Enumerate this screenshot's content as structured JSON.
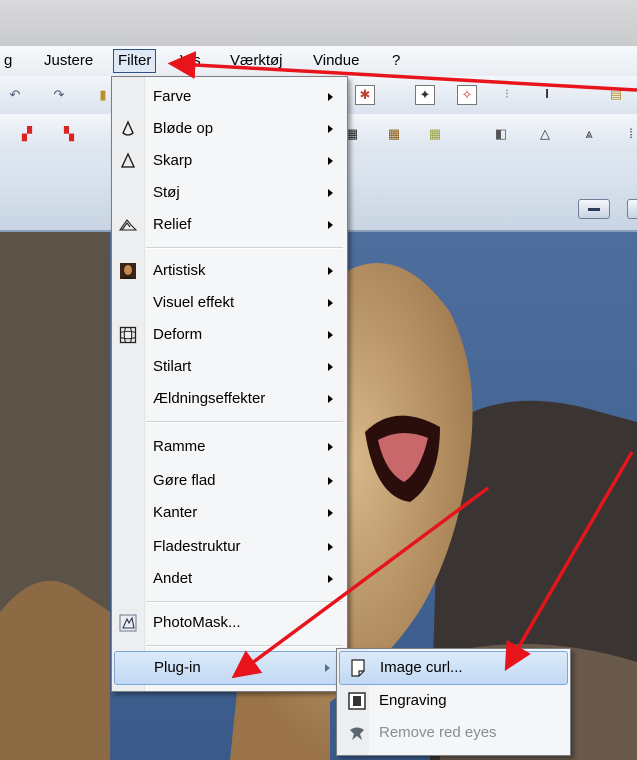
{
  "menubar": {
    "items": [
      "g",
      "Justere",
      "Filter",
      "Vis",
      "Værktøj",
      "Vindue",
      "?"
    ]
  },
  "filter_menu": {
    "items": [
      {
        "label": "Farve",
        "icon": "none",
        "submenu": true
      },
      {
        "label": "Bløde op",
        "icon": "drop-outline-icon",
        "submenu": true
      },
      {
        "label": "Skarp",
        "icon": "triangle-outline-icon",
        "submenu": true
      },
      {
        "label": "Støj",
        "icon": "none",
        "submenu": true
      },
      {
        "label": "Relief",
        "icon": "relief-icon",
        "submenu": true
      },
      {
        "label": "Artistisk",
        "icon": "mona-lisa-icon",
        "submenu": true
      },
      {
        "label": "Visuel effekt",
        "icon": "none",
        "submenu": true
      },
      {
        "label": "Deform",
        "icon": "grid-warp-icon",
        "submenu": true
      },
      {
        "label": "Stilart",
        "icon": "none",
        "submenu": true
      },
      {
        "label": "Ældningseffekter",
        "icon": "none",
        "submenu": true
      },
      {
        "label": "Ramme",
        "icon": "none",
        "submenu": true
      },
      {
        "label": "Gøre flad",
        "icon": "none",
        "submenu": true
      },
      {
        "label": "Kanter",
        "icon": "none",
        "submenu": true
      },
      {
        "label": "Fladestruktur",
        "icon": "none",
        "submenu": true
      },
      {
        "label": "Andet",
        "icon": "none",
        "submenu": true
      },
      {
        "label": "PhotoMask...",
        "icon": "photomask-icon",
        "submenu": false
      },
      {
        "label": "Plug-in",
        "icon": "none",
        "submenu": true,
        "highlighted": true
      }
    ]
  },
  "plugin_submenu": {
    "items": [
      {
        "label": "Image curl...",
        "icon": "page-curl-icon",
        "highlighted": true,
        "disabled": false
      },
      {
        "label": "Engraving",
        "icon": "engraving-icon",
        "highlighted": false,
        "disabled": false
      },
      {
        "label": "Remove red eyes",
        "icon": "red-eye-icon",
        "highlighted": false,
        "disabled": true
      }
    ]
  },
  "annotation_color": "#e8141c",
  "highlight_color": "#c1d9f4"
}
